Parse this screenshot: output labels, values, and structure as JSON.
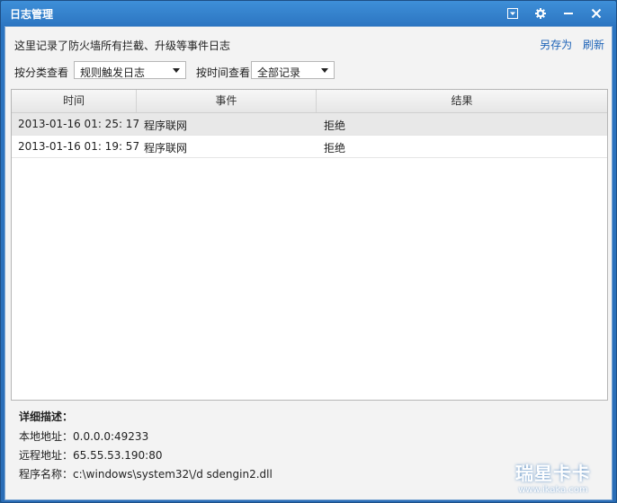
{
  "window": {
    "title": "日志管理"
  },
  "titlebar_buttons": [
    {
      "name": "menu-dropdown-button",
      "glyph": "▾"
    },
    {
      "name": "settings-button",
      "glyph": "⚙"
    },
    {
      "name": "minimize-button",
      "glyph": "—"
    },
    {
      "name": "close-button",
      "glyph": "✕"
    }
  ],
  "header": {
    "description": "这里记录了防火墙所有拦截、升级等事件日志",
    "save_as": "另存为",
    "refresh": "刷新"
  },
  "filters": {
    "category_label": "按分类查看",
    "category_value": "规则触发日志",
    "time_label": "按时间查看",
    "time_value": "全部记录"
  },
  "table": {
    "columns": [
      "时间",
      "事件",
      "结果"
    ],
    "rows": [
      {
        "time": "2013-01-16 01: 25: 17",
        "event": "程序联网",
        "result": "拒绝",
        "selected": true
      },
      {
        "time": "2013-01-16 01: 19: 57",
        "event": "程序联网",
        "result": "拒绝",
        "selected": false
      }
    ]
  },
  "detail": {
    "title": "详细描述：",
    "local_address": "本地地址：0.0.0.0:49233",
    "remote_address": "远程地址：65.55.53.190:80",
    "program_name": "程序名称：c:\\windows\\system32\\/d sdengin2.dll"
  },
  "watermark": {
    "text": "瑞星卡卡",
    "url": "www.ikaka.com"
  }
}
